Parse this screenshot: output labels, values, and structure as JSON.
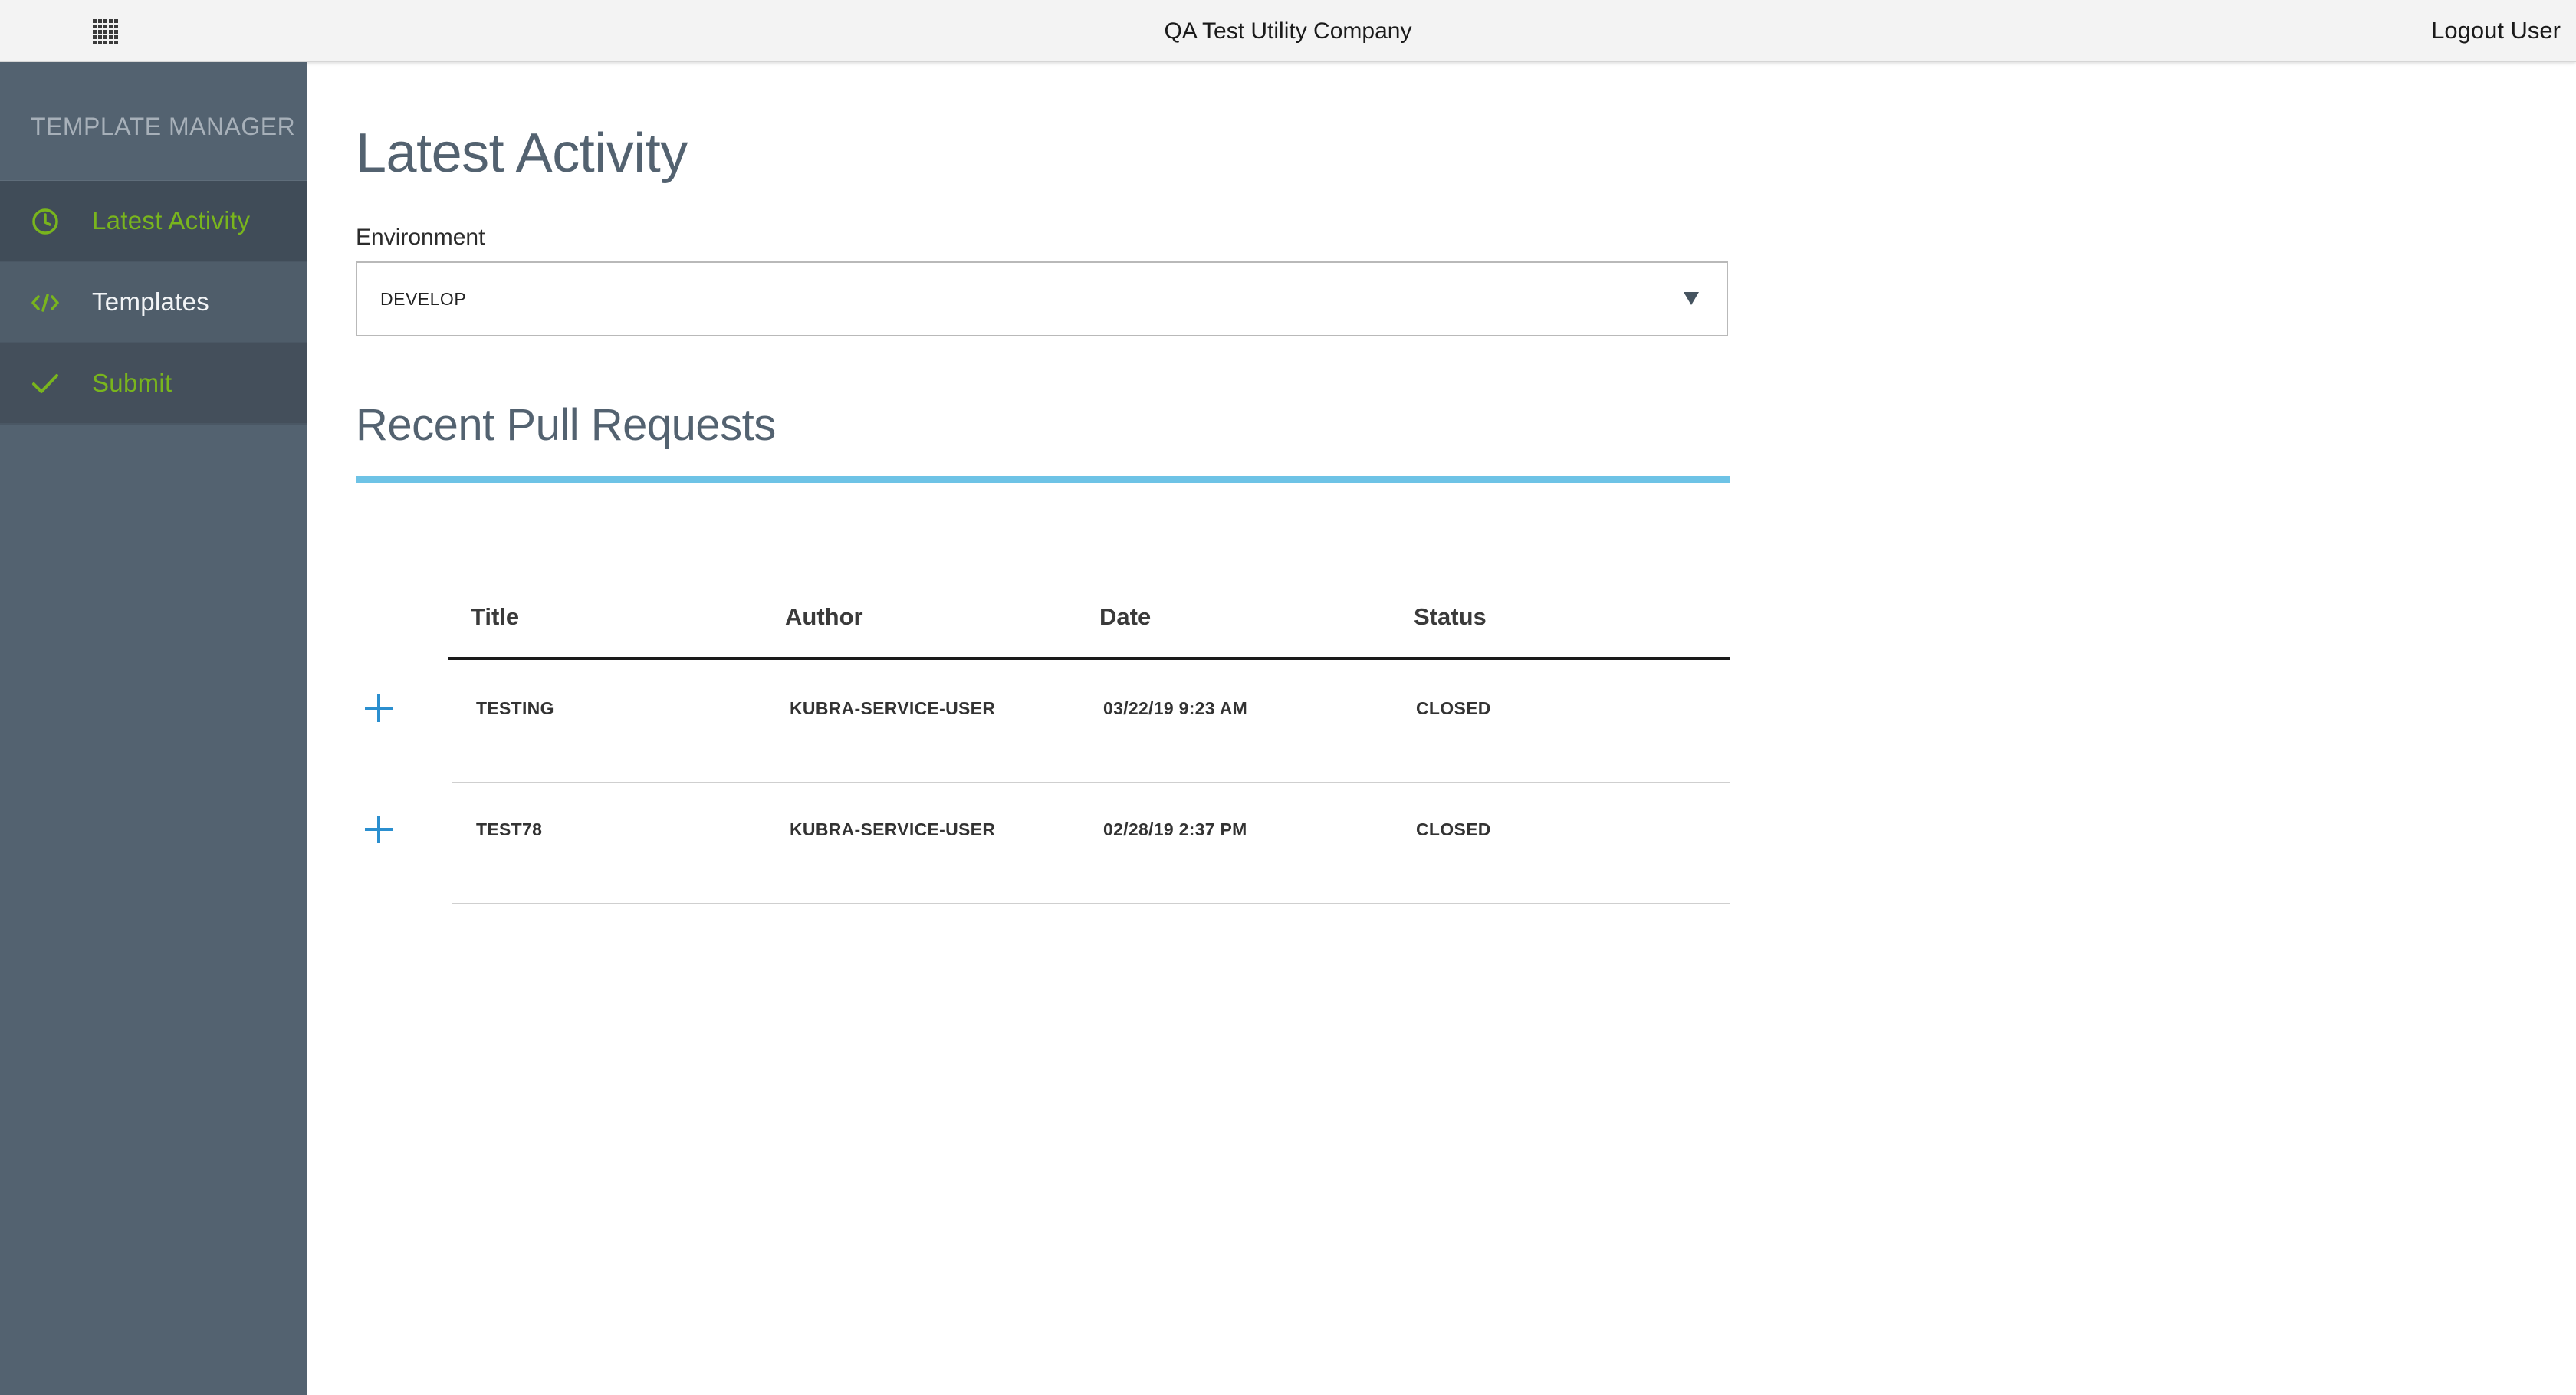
{
  "header": {
    "company": "QA Test Utility Company",
    "logout_label": "Logout User",
    "apps_icon": "apps-grid-icon"
  },
  "sidebar": {
    "title": "TEMPLATE MANAGER",
    "items": [
      {
        "label": "Latest Activity",
        "icon": "clock-icon",
        "active": true
      },
      {
        "label": "Templates",
        "icon": "code-icon",
        "active": false
      },
      {
        "label": "Submit",
        "icon": "check-icon",
        "active": false
      }
    ]
  },
  "main": {
    "title": "Latest Activity",
    "environment": {
      "label": "Environment",
      "selected": "DEVELOP"
    },
    "section_title": "Recent Pull Requests",
    "table": {
      "columns": [
        "Title",
        "Author",
        "Date",
        "Status"
      ],
      "rows": [
        {
          "title": "TESTING",
          "author": "KUBRA-SERVICE-USER",
          "date": "03/22/19 9:23 AM",
          "status": "CLOSED"
        },
        {
          "title": "TEST78",
          "author": "KUBRA-SERVICE-USER",
          "date": "02/28/19 2:37 PM",
          "status": "CLOSED"
        }
      ]
    }
  },
  "colors": {
    "accent_green": "#79b51d",
    "sidebar_bg": "#536270",
    "rule_blue": "#6ec3e6",
    "plus_blue": "#2b8fcf"
  }
}
